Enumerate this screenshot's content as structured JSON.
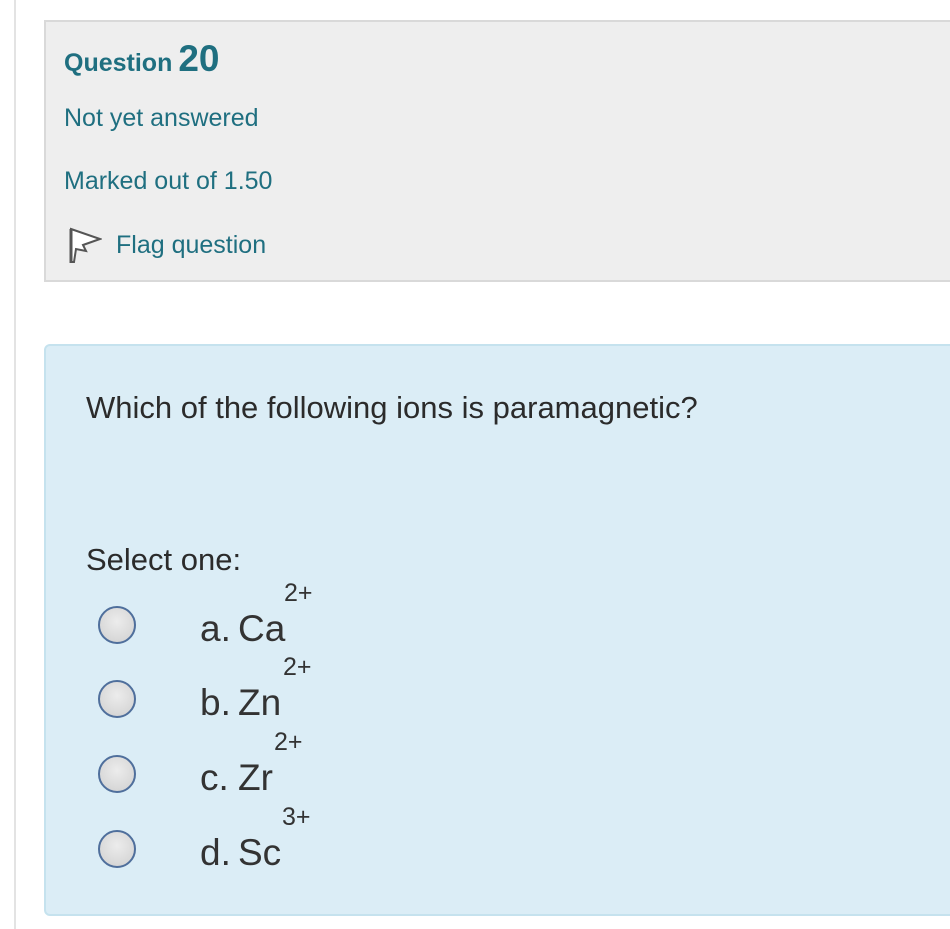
{
  "question_info": {
    "label": "Question",
    "number": "20",
    "status": "Not yet answered",
    "marks": "Marked out of 1.50",
    "flag_label": "Flag question",
    "flag_icon": "flag-icon"
  },
  "question": {
    "text": "Which of the following ions is paramagnetic?",
    "prompt": "Select one:",
    "options": [
      {
        "letter": "a.",
        "symbol": "Ca",
        "charge": "2+",
        "selected": false
      },
      {
        "letter": "b.",
        "symbol": "Zn",
        "charge": "2+",
        "selected": false
      },
      {
        "letter": "c.",
        "symbol": "Zr",
        "charge": "2+",
        "selected": false
      },
      {
        "letter": "d.",
        "symbol": "Sc",
        "charge": "3+",
        "selected": false
      }
    ]
  },
  "colors": {
    "accent": "#1f6f80",
    "info_background": "#eeeeee",
    "question_background": "#dbedf6",
    "text": "#333333"
  }
}
